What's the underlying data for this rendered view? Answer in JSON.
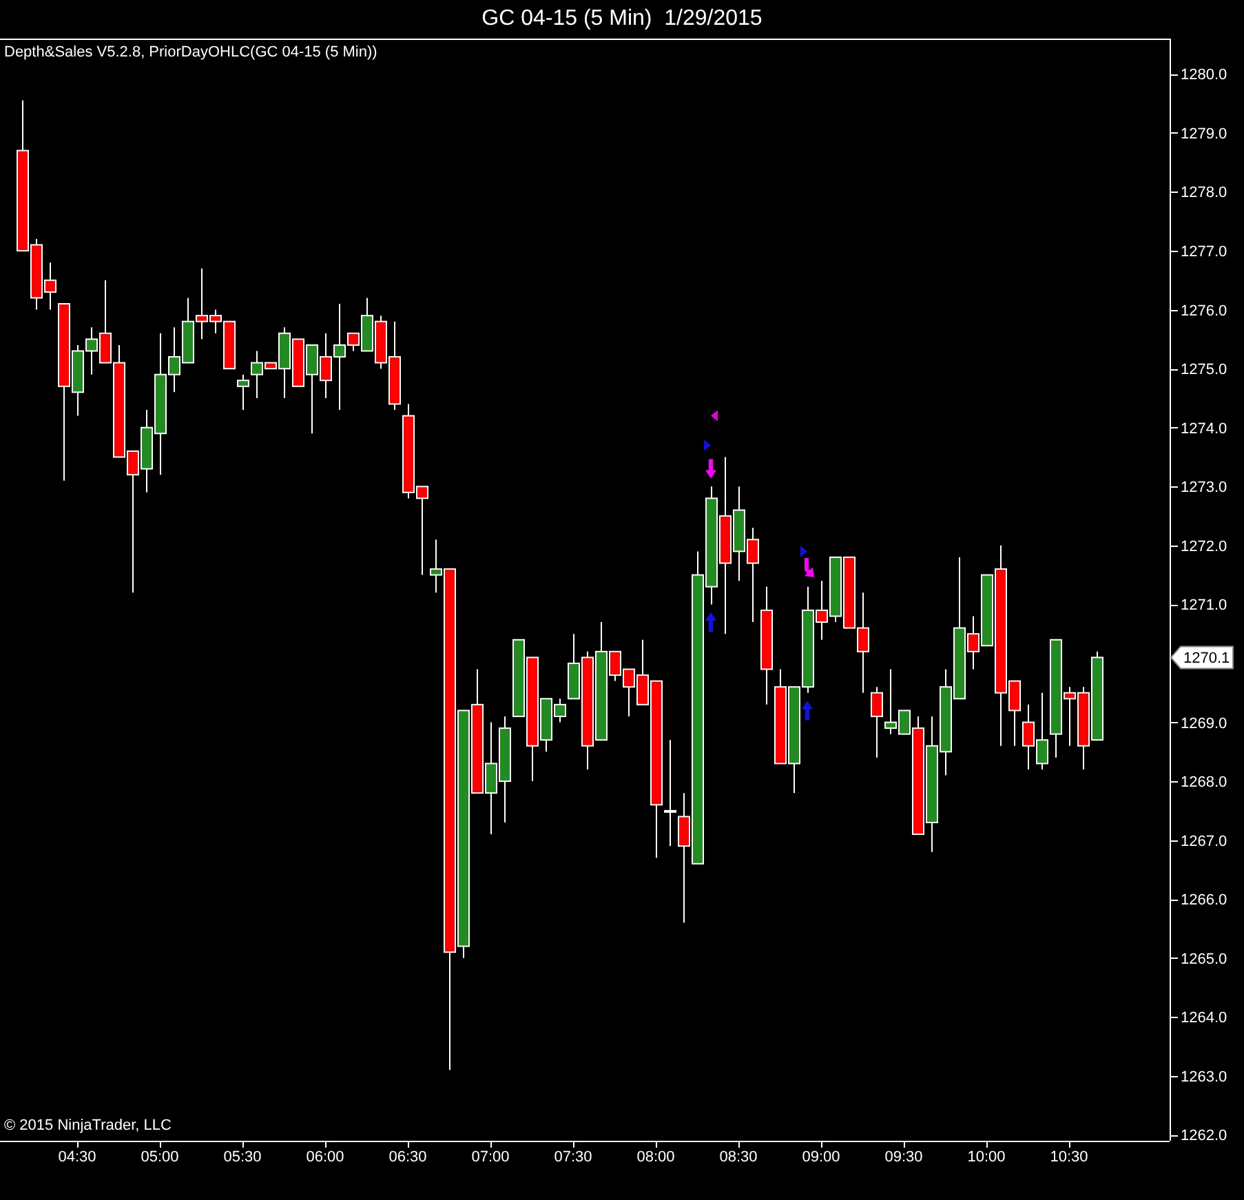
{
  "window": {
    "title": "GC 04-15 (5 Min)  1/29/2015"
  },
  "chart": {
    "indicator_label": "Depth&Sales V5.2.8, PriorDayOHLC(GC 04-15 (5 Min))",
    "copyright": "© 2015 NinjaTrader, LLC",
    "last_price": "1270.1",
    "signals": [
      {
        "kind": "left-triangle",
        "color": "#e000e0"
      },
      {
        "kind": "right-triangle",
        "color": "#1010e8"
      },
      {
        "kind": "down-arrow",
        "color": "#ff00ff"
      },
      {
        "kind": "up-arrow",
        "color": "#1010e8"
      },
      {
        "kind": "right-triangle",
        "color": "#1010e8"
      },
      {
        "kind": "down-right-arrow",
        "color": "#ff00ff"
      },
      {
        "kind": "up-arrow",
        "color": "#1010e8"
      }
    ],
    "chart_data": {
      "type": "candlestick",
      "categories": [
        null,
        null,
        null,
        null,
        "04:30",
        null,
        null,
        null,
        null,
        null,
        "05:00",
        null,
        null,
        null,
        null,
        null,
        "05:30",
        null,
        null,
        null,
        null,
        null,
        "06:00",
        null,
        null,
        null,
        null,
        null,
        "06:30",
        null,
        null,
        null,
        null,
        null,
        "07:00",
        null,
        null,
        null,
        null,
        null,
        "07:30",
        null,
        null,
        null,
        null,
        null,
        "08:00",
        null,
        null,
        null,
        null,
        null,
        "08:30",
        null,
        null,
        null,
        null,
        null,
        "09:00",
        null,
        null,
        null,
        null,
        null,
        "09:30",
        null,
        null,
        null,
        null,
        null,
        "10:00",
        null,
        null,
        null,
        null,
        null,
        "10:30",
        null,
        null
      ],
      "ohlc": [
        [
          1278.7,
          1279.55,
          1277.0,
          1277.0
        ],
        [
          1277.1,
          1277.2,
          1276.0,
          1276.2
        ],
        [
          1276.5,
          1276.8,
          1276.0,
          1276.3
        ],
        [
          1276.1,
          1276.1,
          1273.1,
          1274.7
        ],
        [
          1274.6,
          1275.4,
          1274.2,
          1275.3
        ],
        [
          1275.3,
          1275.7,
          1274.9,
          1275.5
        ],
        [
          1275.6,
          1276.5,
          1275.1,
          1275.1
        ],
        [
          1275.1,
          1275.4,
          1273.5,
          1273.5
        ],
        [
          1273.6,
          1273.6,
          1271.2,
          1273.2
        ],
        [
          1273.3,
          1274.3,
          1272.9,
          1274.0
        ],
        [
          1273.9,
          1275.6,
          1273.2,
          1274.9
        ],
        [
          1274.9,
          1275.7,
          1274.6,
          1275.2
        ],
        [
          1275.1,
          1276.2,
          1275.1,
          1275.8
        ],
        [
          1275.9,
          1276.7,
          1275.5,
          1275.8
        ],
        [
          1275.9,
          1276.0,
          1275.6,
          1275.8
        ],
        [
          1275.8,
          1275.8,
          1275.0,
          1275.0
        ],
        [
          1274.7,
          1274.9,
          1274.3,
          1274.8
        ],
        [
          1274.9,
          1275.3,
          1274.5,
          1275.1
        ],
        [
          1275.1,
          1275.1,
          1275.0,
          1275.0
        ],
        [
          1275.0,
          1275.7,
          1274.5,
          1275.6
        ],
        [
          1275.5,
          1275.5,
          1274.7,
          1274.7
        ],
        [
          1274.9,
          1275.4,
          1273.9,
          1275.4
        ],
        [
          1275.2,
          1275.6,
          1274.5,
          1274.8
        ],
        [
          1275.2,
          1276.1,
          1274.3,
          1275.4
        ],
        [
          1275.6,
          1275.6,
          1275.3,
          1275.4
        ],
        [
          1275.3,
          1276.2,
          1275.3,
          1275.9
        ],
        [
          1275.8,
          1275.9,
          1275.0,
          1275.1
        ],
        [
          1275.2,
          1275.8,
          1274.3,
          1274.4
        ],
        [
          1274.2,
          1274.4,
          1272.8,
          1272.9
        ],
        [
          1273.0,
          1273.0,
          1271.5,
          1272.8
        ],
        [
          1271.5,
          1272.1,
          1271.2,
          1271.6
        ],
        [
          1271.6,
          1271.6,
          1263.1,
          1265.1
        ],
        [
          1265.2,
          1269.2,
          1265.0,
          1269.2
        ],
        [
          1269.3,
          1269.9,
          1267.8,
          1267.8
        ],
        [
          1267.8,
          1269.0,
          1267.1,
          1268.3
        ],
        [
          1268.0,
          1269.1,
          1267.3,
          1268.9
        ],
        [
          1269.1,
          1270.4,
          1269.1,
          1270.4
        ],
        [
          1270.1,
          1270.1,
          1268.0,
          1268.6
        ],
        [
          1268.7,
          1269.4,
          1268.5,
          1269.4
        ],
        [
          1269.1,
          1269.4,
          1269.0,
          1269.3
        ],
        [
          1269.4,
          1270.5,
          1269.4,
          1270.0
        ],
        [
          1270.1,
          1270.2,
          1268.2,
          1268.6
        ],
        [
          1268.7,
          1270.7,
          1268.7,
          1270.2
        ],
        [
          1270.2,
          1270.2,
          1269.7,
          1269.8
        ],
        [
          1269.9,
          1269.9,
          1269.1,
          1269.6
        ],
        [
          1269.8,
          1270.4,
          1269.3,
          1269.3
        ],
        [
          1269.7,
          1269.7,
          1266.7,
          1267.6
        ],
        [
          1267.5,
          1268.7,
          1266.9,
          1267.5
        ],
        [
          1267.4,
          1267.8,
          1265.6,
          1266.9
        ],
        [
          1266.6,
          1271.9,
          1266.6,
          1271.5
        ],
        [
          1271.3,
          1273.0,
          1271.0,
          1272.8
        ],
        [
          1272.5,
          1273.5,
          1270.5,
          1271.7
        ],
        [
          1271.9,
          1273.0,
          1271.4,
          1272.6
        ],
        [
          1272.1,
          1272.3,
          1270.7,
          1271.7
        ],
        [
          1270.9,
          1271.3,
          1269.3,
          1269.9
        ],
        [
          1269.6,
          1269.9,
          1268.3,
          1268.3
        ],
        [
          1268.3,
          1269.6,
          1267.8,
          1269.6
        ],
        [
          1269.6,
          1271.3,
          1269.5,
          1270.9
        ],
        [
          1270.9,
          1271.4,
          1270.4,
          1270.7
        ],
        [
          1270.8,
          1271.8,
          1270.7,
          1271.8
        ],
        [
          1271.8,
          1271.8,
          1270.6,
          1270.6
        ],
        [
          1270.6,
          1271.2,
          1269.5,
          1270.2
        ],
        [
          1269.5,
          1269.6,
          1268.4,
          1269.1
        ],
        [
          1268.9,
          1269.9,
          1268.8,
          1269.0
        ],
        [
          1268.8,
          1269.2,
          1268.8,
          1269.2
        ],
        [
          1268.9,
          1269.1,
          1267.1,
          1267.1
        ],
        [
          1267.3,
          1269.1,
          1266.8,
          1268.6
        ],
        [
          1268.5,
          1269.9,
          1268.1,
          1269.6
        ],
        [
          1269.4,
          1271.8,
          1269.4,
          1270.6
        ],
        [
          1270.5,
          1270.8,
          1269.9,
          1270.2
        ],
        [
          1270.3,
          1271.5,
          1270.3,
          1271.5
        ],
        [
          1271.6,
          1272.0,
          1268.6,
          1269.5
        ],
        [
          1269.7,
          1269.7,
          1268.6,
          1269.2
        ],
        [
          1269.0,
          1269.3,
          1268.2,
          1268.6
        ],
        [
          1268.3,
          1269.5,
          1268.2,
          1268.7
        ],
        [
          1268.8,
          1270.4,
          1268.4,
          1270.4
        ],
        [
          1269.5,
          1269.6,
          1268.6,
          1269.4
        ],
        [
          1269.5,
          1269.6,
          1268.2,
          1268.6
        ],
        [
          1268.7,
          1270.2,
          1268.7,
          1270.1
        ]
      ],
      "ylim": [
        1261.9,
        1280.6
      ],
      "yticks": [
        {
          "value": 1262,
          "label": "1262.0"
        },
        {
          "value": 1263,
          "label": "1263.0"
        },
        {
          "value": 1264,
          "label": "1264.0"
        },
        {
          "value": 1265,
          "label": "1265.0"
        },
        {
          "value": 1266,
          "label": "1266.0"
        },
        {
          "value": 1267,
          "label": "1267.0"
        },
        {
          "value": 1268,
          "label": "1268.0"
        },
        {
          "value": 1269,
          "label": "1269.0"
        },
        {
          "value": 1271,
          "label": "1271.0"
        },
        {
          "value": 1272,
          "label": "1272.0"
        },
        {
          "value": 1273,
          "label": "1273.0"
        },
        {
          "value": 1274,
          "label": "1274.0"
        },
        {
          "value": 1275,
          "label": "1275.0"
        },
        {
          "value": 1276,
          "label": "1276.0"
        },
        {
          "value": 1277,
          "label": "1277.0"
        },
        {
          "value": 1278,
          "label": "1278.0"
        },
        {
          "value": 1279,
          "label": "1279.0"
        },
        {
          "value": 1280,
          "label": "1280.0"
        }
      ],
      "title": null
    }
  }
}
